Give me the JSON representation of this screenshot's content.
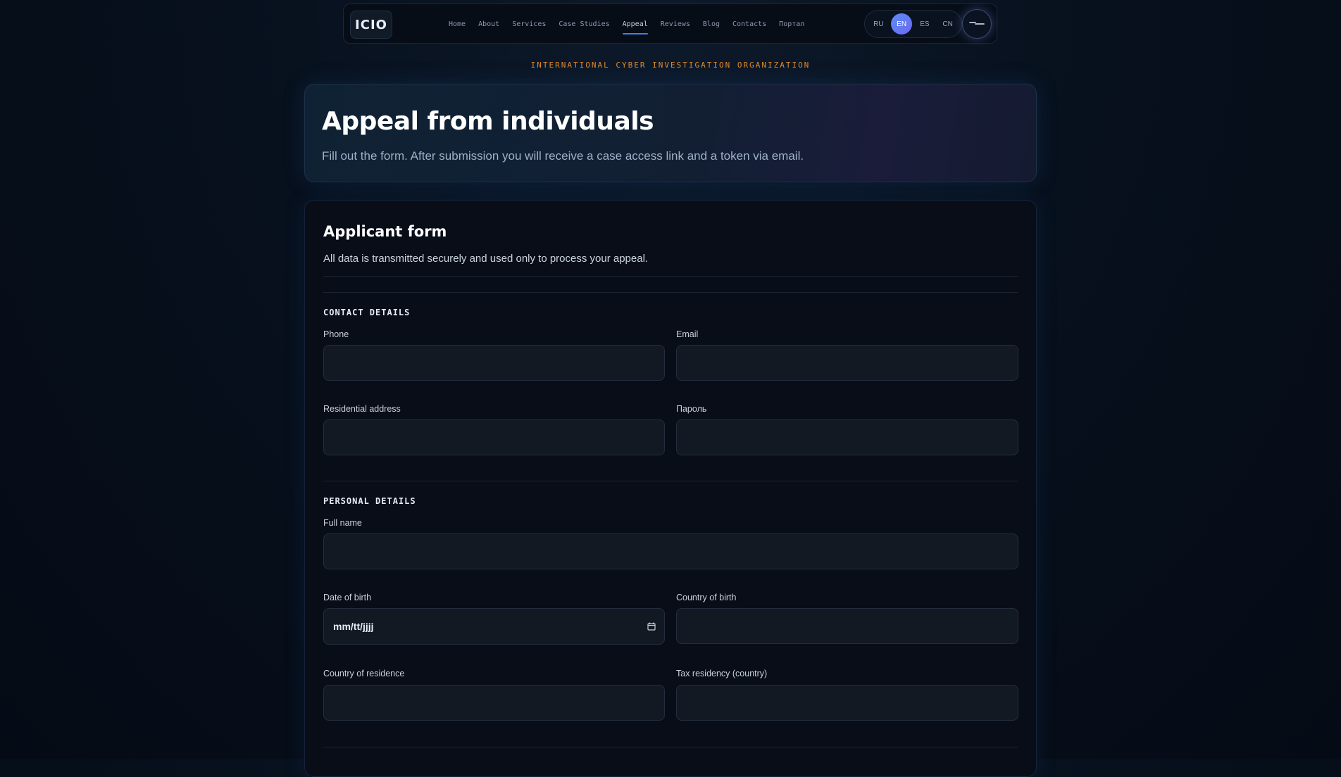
{
  "nav": {
    "logo": "ICIO",
    "links": [
      "Home",
      "About",
      "Services",
      "Case Studies",
      "Appeal",
      "Reviews",
      "Blog",
      "Contacts",
      "Портал"
    ],
    "active_link": "Appeal",
    "languages": [
      "RU",
      "EN",
      "ES",
      "CN"
    ],
    "active_language": "EN",
    "menu_icon": "menu-icon"
  },
  "org_name": "INTERNATIONAL CYBER INVESTIGATION ORGANIZATION",
  "hero": {
    "title": "Appeal from individuals",
    "subtitle": "Fill out the form. After submission you will receive a case access link and a token via email."
  },
  "form": {
    "title": "Applicant form",
    "subtitle": "All data is transmitted securely and used only to process your appeal.",
    "contact_section": "CONTACT DETAILS",
    "phone_label": "Phone",
    "email_label": "Email",
    "address_label": "Residential address",
    "password_label": "Пароль",
    "personal_section": "PERSONAL DETAILS",
    "fullname_label": "Full name",
    "dob_label": "Date of birth",
    "dob_placeholder": "mm/tt/jjjj",
    "country_birth_label": "Country of birth",
    "country_residence_label": "Country of residence",
    "tax_residency_label": "Tax residency (country)"
  },
  "colors": {
    "accent": "#3b82f6",
    "org_text": "#e18a2c",
    "background": "#07101d"
  }
}
